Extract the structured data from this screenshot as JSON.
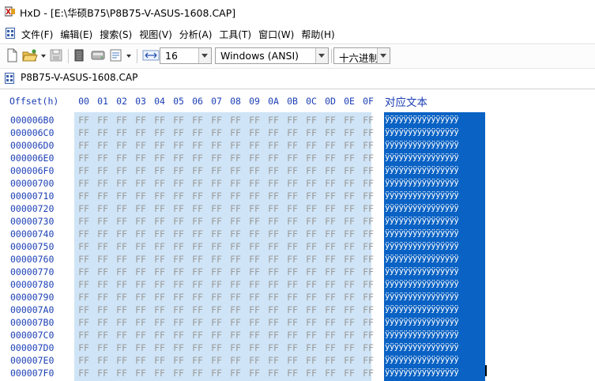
{
  "window": {
    "title": "HxD - [E:\\华硕B75\\P8B75-V-ASUS-1608.CAP]"
  },
  "menu": {
    "items": [
      "文件(F)",
      "编辑(E)",
      "搜索(S)",
      "视图(V)",
      "分析(A)",
      "工具(T)",
      "窗口(W)",
      "帮助(H)"
    ]
  },
  "toolbar": {
    "bytes_per_row": "16",
    "charset": "Windows (ANSI)",
    "offset_base": "十六进制"
  },
  "tab": {
    "label": "P8B75-V-ASUS-1608.CAP"
  },
  "hex": {
    "offset_header": "Offset(h)",
    "columns": [
      "00",
      "01",
      "02",
      "03",
      "04",
      "05",
      "06",
      "07",
      "08",
      "09",
      "0A",
      "0B",
      "0C",
      "0D",
      "0E",
      "0F"
    ],
    "text_header": "对应文本",
    "rows": [
      {
        "offset": "000006B0",
        "bytes": [
          "FF",
          "FF",
          "FF",
          "FF",
          "FF",
          "FF",
          "FF",
          "FF",
          "FF",
          "FF",
          "FF",
          "FF",
          "FF",
          "FF",
          "FF",
          "FF"
        ],
        "text": "ÿÿÿÿÿÿÿÿÿÿÿÿÿÿÿÿ"
      },
      {
        "offset": "000006C0",
        "bytes": [
          "FF",
          "FF",
          "FF",
          "FF",
          "FF",
          "FF",
          "FF",
          "FF",
          "FF",
          "FF",
          "FF",
          "FF",
          "FF",
          "FF",
          "FF",
          "FF"
        ],
        "text": "ÿÿÿÿÿÿÿÿÿÿÿÿÿÿÿÿ"
      },
      {
        "offset": "000006D0",
        "bytes": [
          "FF",
          "FF",
          "FF",
          "FF",
          "FF",
          "FF",
          "FF",
          "FF",
          "FF",
          "FF",
          "FF",
          "FF",
          "FF",
          "FF",
          "FF",
          "FF"
        ],
        "text": "ÿÿÿÿÿÿÿÿÿÿÿÿÿÿÿÿ"
      },
      {
        "offset": "000006E0",
        "bytes": [
          "FF",
          "FF",
          "FF",
          "FF",
          "FF",
          "FF",
          "FF",
          "FF",
          "FF",
          "FF",
          "FF",
          "FF",
          "FF",
          "FF",
          "FF",
          "FF"
        ],
        "text": "ÿÿÿÿÿÿÿÿÿÿÿÿÿÿÿÿ"
      },
      {
        "offset": "000006F0",
        "bytes": [
          "FF",
          "FF",
          "FF",
          "FF",
          "FF",
          "FF",
          "FF",
          "FF",
          "FF",
          "FF",
          "FF",
          "FF",
          "FF",
          "FF",
          "FF",
          "FF"
        ],
        "text": "ÿÿÿÿÿÿÿÿÿÿÿÿÿÿÿÿ"
      },
      {
        "offset": "00000700",
        "bytes": [
          "FF",
          "FF",
          "FF",
          "FF",
          "FF",
          "FF",
          "FF",
          "FF",
          "FF",
          "FF",
          "FF",
          "FF",
          "FF",
          "FF",
          "FF",
          "FF"
        ],
        "text": "ÿÿÿÿÿÿÿÿÿÿÿÿÿÿÿÿ"
      },
      {
        "offset": "00000710",
        "bytes": [
          "FF",
          "FF",
          "FF",
          "FF",
          "FF",
          "FF",
          "FF",
          "FF",
          "FF",
          "FF",
          "FF",
          "FF",
          "FF",
          "FF",
          "FF",
          "FF"
        ],
        "text": "ÿÿÿÿÿÿÿÿÿÿÿÿÿÿÿÿ"
      },
      {
        "offset": "00000720",
        "bytes": [
          "FF",
          "FF",
          "FF",
          "FF",
          "FF",
          "FF",
          "FF",
          "FF",
          "FF",
          "FF",
          "FF",
          "FF",
          "FF",
          "FF",
          "FF",
          "FF"
        ],
        "text": "ÿÿÿÿÿÿÿÿÿÿÿÿÿÿÿÿ"
      },
      {
        "offset": "00000730",
        "bytes": [
          "FF",
          "FF",
          "FF",
          "FF",
          "FF",
          "FF",
          "FF",
          "FF",
          "FF",
          "FF",
          "FF",
          "FF",
          "FF",
          "FF",
          "FF",
          "FF"
        ],
        "text": "ÿÿÿÿÿÿÿÿÿÿÿÿÿÿÿÿ"
      },
      {
        "offset": "00000740",
        "bytes": [
          "FF",
          "FF",
          "FF",
          "FF",
          "FF",
          "FF",
          "FF",
          "FF",
          "FF",
          "FF",
          "FF",
          "FF",
          "FF",
          "FF",
          "FF",
          "FF"
        ],
        "text": "ÿÿÿÿÿÿÿÿÿÿÿÿÿÿÿÿ"
      },
      {
        "offset": "00000750",
        "bytes": [
          "FF",
          "FF",
          "FF",
          "FF",
          "FF",
          "FF",
          "FF",
          "FF",
          "FF",
          "FF",
          "FF",
          "FF",
          "FF",
          "FF",
          "FF",
          "FF"
        ],
        "text": "ÿÿÿÿÿÿÿÿÿÿÿÿÿÿÿÿ"
      },
      {
        "offset": "00000760",
        "bytes": [
          "FF",
          "FF",
          "FF",
          "FF",
          "FF",
          "FF",
          "FF",
          "FF",
          "FF",
          "FF",
          "FF",
          "FF",
          "FF",
          "FF",
          "FF",
          "FF"
        ],
        "text": "ÿÿÿÿÿÿÿÿÿÿÿÿÿÿÿÿ"
      },
      {
        "offset": "00000770",
        "bytes": [
          "FF",
          "FF",
          "FF",
          "FF",
          "FF",
          "FF",
          "FF",
          "FF",
          "FF",
          "FF",
          "FF",
          "FF",
          "FF",
          "FF",
          "FF",
          "FF"
        ],
        "text": "ÿÿÿÿÿÿÿÿÿÿÿÿÿÿÿÿ"
      },
      {
        "offset": "00000780",
        "bytes": [
          "FF",
          "FF",
          "FF",
          "FF",
          "FF",
          "FF",
          "FF",
          "FF",
          "FF",
          "FF",
          "FF",
          "FF",
          "FF",
          "FF",
          "FF",
          "FF"
        ],
        "text": "ÿÿÿÿÿÿÿÿÿÿÿÿÿÿÿÿ"
      },
      {
        "offset": "00000790",
        "bytes": [
          "FF",
          "FF",
          "FF",
          "FF",
          "FF",
          "FF",
          "FF",
          "FF",
          "FF",
          "FF",
          "FF",
          "FF",
          "FF",
          "FF",
          "FF",
          "FF"
        ],
        "text": "ÿÿÿÿÿÿÿÿÿÿÿÿÿÿÿÿ"
      },
      {
        "offset": "000007A0",
        "bytes": [
          "FF",
          "FF",
          "FF",
          "FF",
          "FF",
          "FF",
          "FF",
          "FF",
          "FF",
          "FF",
          "FF",
          "FF",
          "FF",
          "FF",
          "FF",
          "FF"
        ],
        "text": "ÿÿÿÿÿÿÿÿÿÿÿÿÿÿÿÿ"
      },
      {
        "offset": "000007B0",
        "bytes": [
          "FF",
          "FF",
          "FF",
          "FF",
          "FF",
          "FF",
          "FF",
          "FF",
          "FF",
          "FF",
          "FF",
          "FF",
          "FF",
          "FF",
          "FF",
          "FF"
        ],
        "text": "ÿÿÿÿÿÿÿÿÿÿÿÿÿÿÿÿ"
      },
      {
        "offset": "000007C0",
        "bytes": [
          "FF",
          "FF",
          "FF",
          "FF",
          "FF",
          "FF",
          "FF",
          "FF",
          "FF",
          "FF",
          "FF",
          "FF",
          "FF",
          "FF",
          "FF",
          "FF"
        ],
        "text": "ÿÿÿÿÿÿÿÿÿÿÿÿÿÿÿÿ"
      },
      {
        "offset": "000007D0",
        "bytes": [
          "FF",
          "FF",
          "FF",
          "FF",
          "FF",
          "FF",
          "FF",
          "FF",
          "FF",
          "FF",
          "FF",
          "FF",
          "FF",
          "FF",
          "FF",
          "FF"
        ],
        "text": "ÿÿÿÿÿÿÿÿÿÿÿÿÿÿÿÿ"
      },
      {
        "offset": "000007E0",
        "bytes": [
          "FF",
          "FF",
          "FF",
          "FF",
          "FF",
          "FF",
          "FF",
          "FF",
          "FF",
          "FF",
          "FF",
          "FF",
          "FF",
          "FF",
          "FF",
          "FF"
        ],
        "text": "ÿÿÿÿÿÿÿÿÿÿÿÿÿÿÿÿ"
      },
      {
        "offset": "000007F0",
        "bytes": [
          "FF",
          "FF",
          "FF",
          "FF",
          "FF",
          "FF",
          "FF",
          "FF",
          "FF",
          "FF",
          "FF",
          "FF",
          "FF",
          "FF",
          "FF",
          "FF"
        ],
        "text": "ÿÿÿÿÿÿÿÿÿÿÿÿÿÿÿÿ"
      }
    ]
  },
  "colors": {
    "offset_text": "#1c3fb5",
    "hex_selection": "#cfe4f6",
    "text_selection": "#0a62c4",
    "byte_text": "#9a9a9a"
  }
}
